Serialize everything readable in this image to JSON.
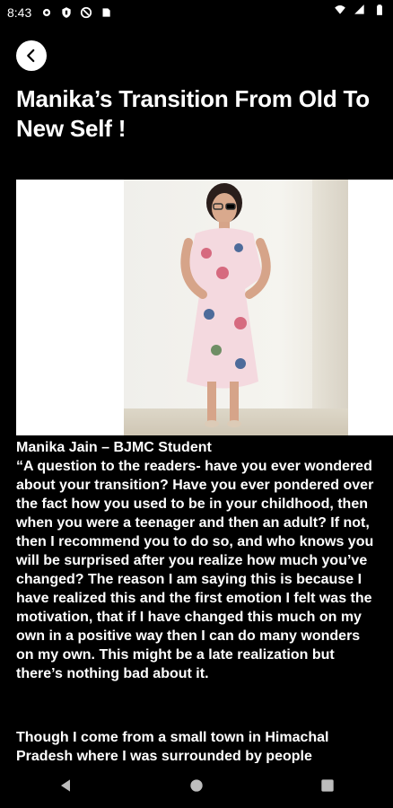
{
  "status_bar": {
    "time": "8:43",
    "icons_left": [
      "gear-icon",
      "shield-icon",
      "do-not-disturb-icon",
      "sd-card-icon"
    ],
    "icons_right": [
      "wifi-icon",
      "signal-icon",
      "battery-icon"
    ]
  },
  "header": {
    "title": "Manika’s Transition From Old To New Self !"
  },
  "article": {
    "caption": "Manika Jain – BJMC Student",
    "paragraph1": "“A question to the readers- have you ever wondered about your transition? Have you ever pondered over the fact how you used to be in your childhood, then when you were a teenager and then an adult? If not, then I recommend you to do so, and who knows you will be surprised after you realize how much you’ve changed? The reason I am saying this is because I have realized this and the first emotion I felt was the motivation, that if I have changed this much on my own in a positive way then I can do many wonders on my own. This might be a late realization but there’s nothing bad about it.",
    "paragraph2": "Though I come from a small town in Himachal Pradesh where I was surrounded by people"
  },
  "nav": {
    "icons": [
      "back-triangle-icon",
      "home-circle-icon",
      "recents-square-icon"
    ]
  },
  "colors": {
    "background": "#000000",
    "text": "#ffffff"
  }
}
